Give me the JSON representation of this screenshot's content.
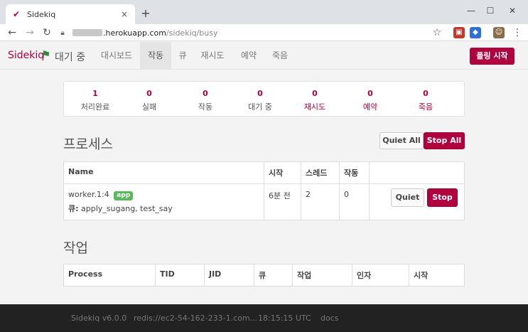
{
  "browser": {
    "tab_title": "Sidekiq",
    "tab_close": "×",
    "new_tab": "+",
    "url_host": ".herokuapp.com",
    "url_path": "/sidekiq/busy"
  },
  "app": {
    "brand": "Sidekiq",
    "status": "대기 중",
    "nav": [
      "대시보드",
      "작동",
      "큐",
      "재시도",
      "예약",
      "죽음"
    ],
    "active_nav": "작동",
    "poll_button": "폴링 시작"
  },
  "stats": [
    {
      "value": "1",
      "label": "처리완료"
    },
    {
      "value": "0",
      "label": "실패"
    },
    {
      "value": "0",
      "label": "작동"
    },
    {
      "value": "0",
      "label": "대기 중"
    },
    {
      "value": "0",
      "label": "재시도"
    },
    {
      "value": "0",
      "label": "예약"
    },
    {
      "value": "0",
      "label": "죽음"
    }
  ],
  "processes": {
    "title": "프로세스",
    "quiet_all": "Quiet All",
    "stop_all": "Stop All",
    "headers": [
      "Name",
      "시작",
      "스레드",
      "작동"
    ],
    "rows": [
      {
        "name": "worker.1:4",
        "tag": "app",
        "queues_label": "큐:",
        "queues": "apply_sugang, test_say",
        "started": "6분 전",
        "threads": "2",
        "busy": "0",
        "quiet": "Quiet",
        "stop": "Stop"
      }
    ]
  },
  "jobs": {
    "title": "작업",
    "headers": [
      "Process",
      "TID",
      "JID",
      "큐",
      "작업",
      "인자",
      "시작"
    ]
  },
  "footer": {
    "version": "Sidekiq v6.0.0",
    "redis": "redis://ec2-54-162-233-1.com...",
    "time": "18:15:15 UTC",
    "docs": "docs"
  },
  "colors": {
    "accent": "#b1003e",
    "badge": "#5cb85c",
    "footer": "#222222"
  }
}
